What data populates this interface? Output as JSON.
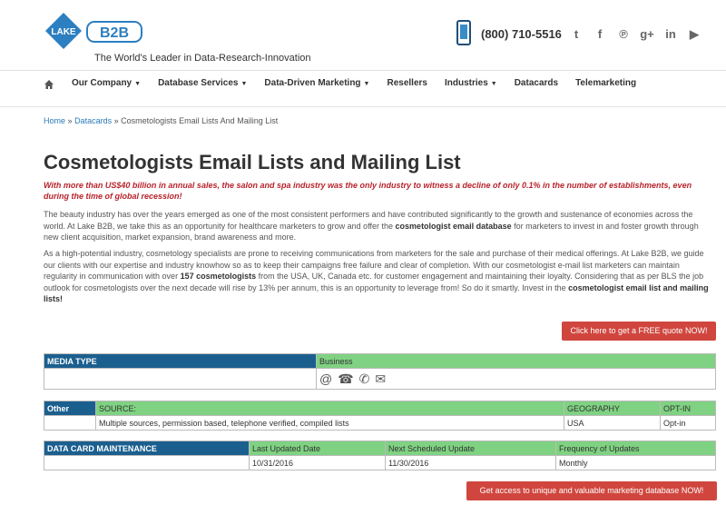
{
  "header": {
    "logo_text_left": "LAKE",
    "logo_text_right": "B2B",
    "tagline": "The World's Leader in Data-Research-Innovation",
    "phone": "(800) 710-5516",
    "socials": [
      {
        "icon": "twitter-icon",
        "glyph": "🐦"
      },
      {
        "icon": "facebook-icon",
        "glyph": "f"
      },
      {
        "icon": "pinterest-icon",
        "glyph": "P"
      },
      {
        "icon": "google-plus-icon",
        "glyph": "g+"
      },
      {
        "icon": "linkedin-icon",
        "glyph": "in"
      },
      {
        "icon": "youtube-icon",
        "glyph": "▶"
      }
    ]
  },
  "nav": {
    "items": [
      {
        "label": "Our Company",
        "dropdown": true
      },
      {
        "label": "Database Services",
        "dropdown": true
      },
      {
        "label": "Data-Driven Marketing",
        "dropdown": true
      },
      {
        "label": "Resellers",
        "dropdown": false
      },
      {
        "label": "Industries",
        "dropdown": true
      },
      {
        "label": "Datacards",
        "dropdown": false
      },
      {
        "label": "Telemarketing",
        "dropdown": false
      }
    ]
  },
  "breadcrumb": {
    "home": "Home",
    "sep": "»",
    "datacards": "Datacards",
    "current": "Cosmetologists Email Lists And Mailing List"
  },
  "page": {
    "title": "Cosmetologists Email Lists and Mailing List",
    "lead": "With more than US$40 billion in annual sales, the salon and spa industry was the only industry to witness a decline of only 0.1% in the number of establishments, even during the time of global recession!",
    "p1_a": "The beauty industry has over the years emerged as one of the most consistent performers and have contributed significantly to the growth and sustenance of economies across the world. At Lake B2B, we take this as an opportunity for healthcare marketers to grow and offer the ",
    "p1_b": "cosmetologist email database",
    "p1_c": " for marketers to invest in and foster growth through new client acquisition, market expansion, brand awareness and more.",
    "p2_a": "As a high-potential industry, cosmetology specialists are prone to receiving communications from marketers for the sale and purchase of their medical offerings. At Lake B2B, we guide our clients with our expertise and industry knowhow so as to keep their campaigns free failure and clear of completion. With our cosmetologist e-mail list marketers can maintain regularity in communication with over ",
    "p2_b": "157 cosmetologists",
    "p2_c": " from the USA, UK, Canada etc. for customer engagement and maintaining their loyalty. Considering that as per BLS the job outlook for cosmetologists over the next decade will rise by 13% per annum, this is an opportunity to leverage from! So do it smartly. Invest in the ",
    "p2_d": "cosmetologist email list and mailing lists!",
    "quote_btn": "Click here to get a FREE quote NOW!",
    "access_btn": "Get access to unique and valuable marketing database NOW!"
  },
  "media_table": {
    "header": "MEDIA TYPE",
    "type": "Business"
  },
  "other_table": {
    "header": "Other",
    "source_h": "SOURCE:",
    "geo_h": "GEOGRAPHY",
    "opt_h": "OPT-IN",
    "source": "Multiple sources, permission based, telephone verified, compiled lists",
    "geo": "USA",
    "opt": "Opt-in"
  },
  "maint_table": {
    "header": "DATA CARD MAINTENANCE",
    "last_h": "Last Updated Date",
    "next_h": "Next Scheduled Update",
    "freq_h": "Frequency of Updates",
    "last": "10/31/2016",
    "next": "11/30/2016",
    "freq": "Monthly"
  }
}
